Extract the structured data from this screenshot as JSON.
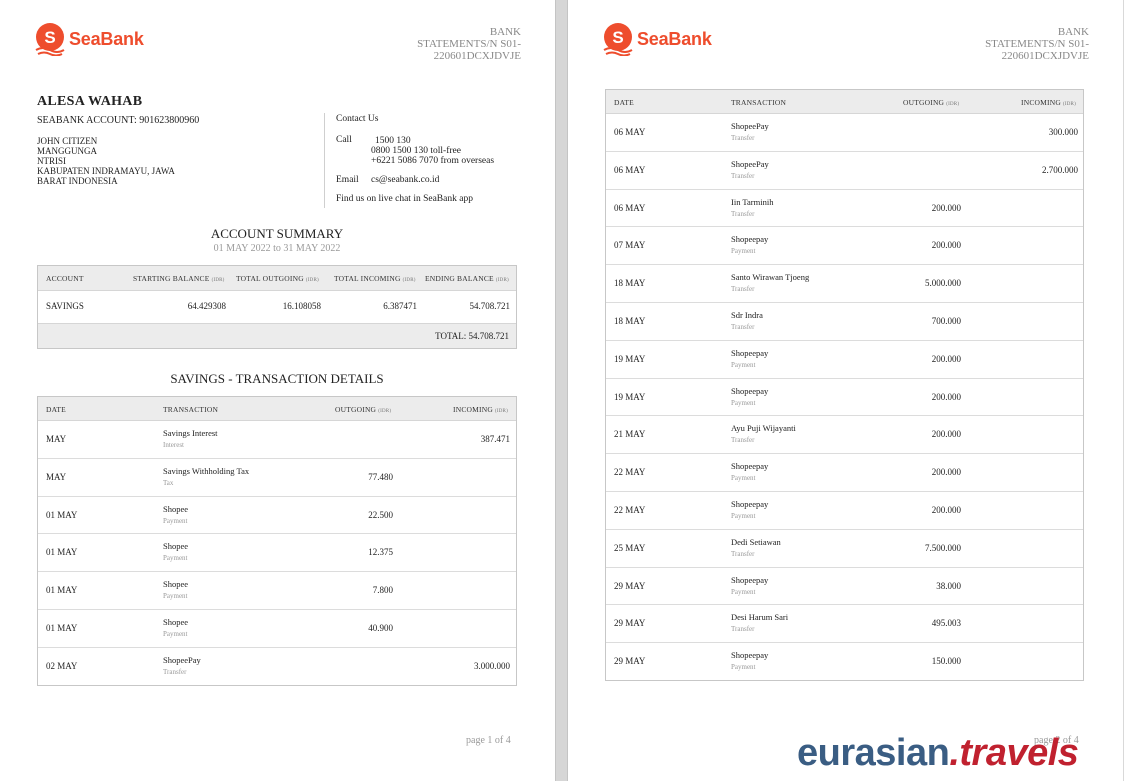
{
  "brand": {
    "name": "SeaBank",
    "color": "#ee4d2d"
  },
  "statement": {
    "line1": "BANK",
    "line2": "STATEMENTS/N  S01-",
    "line3": "220601DCXJDVJE"
  },
  "customer": {
    "name": "ALESA WAHAB",
    "account": "SEABANK ACCOUNT: 901623800960",
    "address": [
      "JOHN CITIZEN",
      "MANGGUNGA",
      "NTRISI",
      "KABUPATEN INDRAMAYU, JAWA",
      "BARAT INDONESIA"
    ]
  },
  "contact": {
    "title": "Contact Us",
    "call_label": "Call",
    "call_lines": [
      "1500 130",
      "0800 1500 130 toll-free",
      "+6221 5086 7070 from overseas"
    ],
    "email_label": "Email",
    "email": "cs@seabank.co.id",
    "chat": "Find us on live chat in SeaBank app"
  },
  "summary": {
    "title": "ACCOUNT SUMMARY",
    "period": "01 MAY 2022 to 31 MAY 2022",
    "headers": {
      "account": "ACCOUNT",
      "starting": "STARTING BALANCE",
      "outgoing": "TOTAL OUTGOING",
      "incoming": "TOTAL INCOMING",
      "ending": "ENDING BALANCE",
      "unit": "(IDR)"
    },
    "row": {
      "account": "SAVINGS",
      "starting": "64.429308",
      "outgoing": "16.108058",
      "incoming": "6.387471",
      "ending": "54.708.721"
    },
    "total": "TOTAL: 54.708.721"
  },
  "details": {
    "title": "SAVINGS - TRANSACTION DETAILS",
    "headers": {
      "date": "DATE",
      "transaction": "TRANSACTION",
      "outgoing": "OUTGOING",
      "incoming": "INCOMING",
      "unit": "(IDR)"
    }
  },
  "transactions_page1": [
    {
      "date": "MAY",
      "name": "Savings  Interest",
      "type": "Interest",
      "out": "",
      "in": "387.471"
    },
    {
      "date": "MAY",
      "name": "Savings Withholding Tax",
      "type": "Tax",
      "out": "77.480",
      "in": ""
    },
    {
      "date": "01 MAY",
      "name": "Shopee",
      "type": "Payment",
      "out": "22.500",
      "in": ""
    },
    {
      "date": "01 MAY",
      "name": "Shopee",
      "type": "Payment",
      "out": "12.375",
      "in": ""
    },
    {
      "date": "01 MAY",
      "name": "Shopee",
      "type": "Payment",
      "out": "7.800",
      "in": ""
    },
    {
      "date": "01 MAY",
      "name": "Shopee",
      "type": "Payment",
      "out": "40.900",
      "in": ""
    },
    {
      "date": "02 MAY",
      "name": "ShopeePay",
      "type": "Transfer",
      "out": "",
      "in": "3.000.000"
    }
  ],
  "transactions_page2": [
    {
      "date": "06 MAY",
      "name": "ShopeePay",
      "type": "Transfer",
      "out": "",
      "in": "300.000"
    },
    {
      "date": "06 MAY",
      "name": "ShopeePay",
      "type": "Transfer",
      "out": "",
      "in": "2.700.000"
    },
    {
      "date": "06 MAY",
      "name": "Iin Tarminih",
      "type": "Transfer",
      "out": "200.000",
      "in": ""
    },
    {
      "date": "07 MAY",
      "name": "Shopeepay",
      "type": "Payment",
      "out": "200.000",
      "in": ""
    },
    {
      "date": "18 MAY",
      "name": "Santo Wirawan Tjoeng",
      "type": "Transfer",
      "out": "5.000.000",
      "in": ""
    },
    {
      "date": "18 MAY",
      "name": "Sdr Indra",
      "type": "Transfer",
      "out": "700.000",
      "in": ""
    },
    {
      "date": "19 MAY",
      "name": "Shopeepay",
      "type": "Payment",
      "out": "200.000",
      "in": ""
    },
    {
      "date": "19 MAY",
      "name": "Shopeepay",
      "type": "Payment",
      "out": "200.000",
      "in": ""
    },
    {
      "date": "21 MAY",
      "name": "Ayu Puji Wijayanti",
      "type": "Transfer",
      "out": "200.000",
      "in": ""
    },
    {
      "date": "22 MAY",
      "name": "Shopeepay",
      "type": "Payment",
      "out": "200.000",
      "in": ""
    },
    {
      "date": "22 MAY",
      "name": "Shopeepay",
      "type": "Payment",
      "out": "200.000",
      "in": ""
    },
    {
      "date": "25 MAY",
      "name": "Dedi Setiawan",
      "type": "Transfer",
      "out": "7.500.000",
      "in": ""
    },
    {
      "date": "29 MAY",
      "name": "Shopeepay",
      "type": "Payment",
      "out": "38.000",
      "in": ""
    },
    {
      "date": "29 MAY",
      "name": "Desi Harum Sari",
      "type": "Transfer",
      "out": "495.003",
      "in": ""
    },
    {
      "date": "29 MAY",
      "name": "Shopeepay",
      "type": "Payment",
      "out": "150.000",
      "in": ""
    }
  ],
  "pages": {
    "p1": "page 1 of 4",
    "p2": "page 2 of 4"
  },
  "watermark": {
    "main": "eurasian",
    "suffix": ".travels"
  }
}
